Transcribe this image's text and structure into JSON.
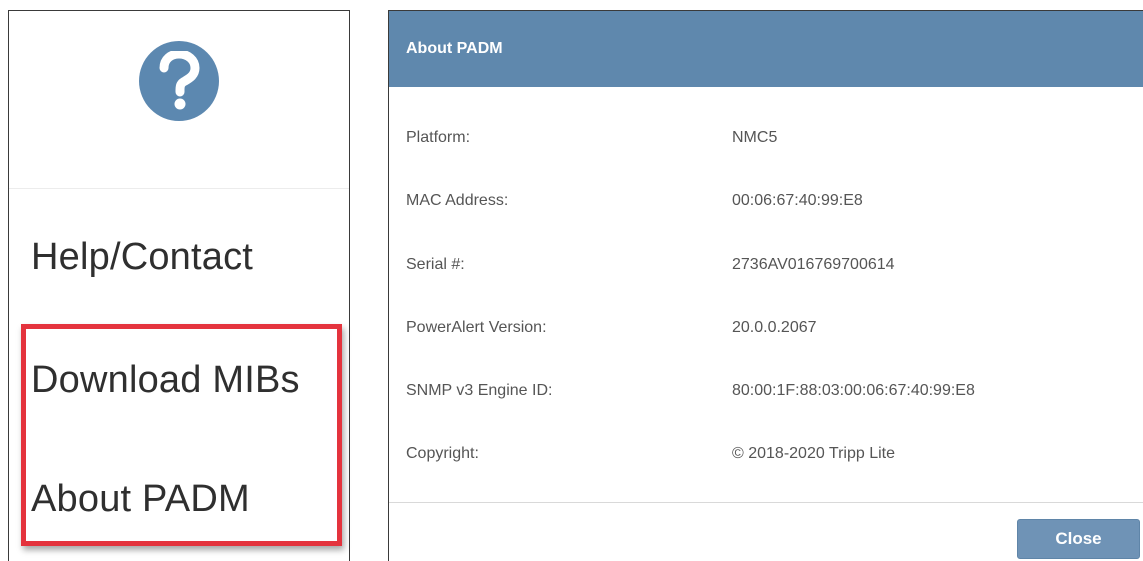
{
  "help_menu": {
    "icon": "question-mark-icon",
    "icon_color": "#5c88b0",
    "items": [
      {
        "label": "Help/Contact"
      },
      {
        "label": "Download MIBs"
      },
      {
        "label": "About PADM"
      }
    ],
    "highlight_color": "#e4333d"
  },
  "dialog": {
    "title": "About PADM",
    "header_color": "#5f88ad",
    "rows": [
      {
        "label": "Platform:",
        "value": "NMC5"
      },
      {
        "label": "MAC Address:",
        "value": "00:06:67:40:99:E8"
      },
      {
        "label": "Serial #:",
        "value": "2736AV016769700614"
      },
      {
        "label": "PowerAlert Version:",
        "value": "20.0.0.2067"
      },
      {
        "label": "SNMP v3 Engine ID:",
        "value": "80:00:1F:88:03:00:06:67:40:99:E8"
      },
      {
        "label": "Copyright:",
        "value": "© 2018-2020 Tripp Lite"
      }
    ],
    "close_label": "Close"
  }
}
